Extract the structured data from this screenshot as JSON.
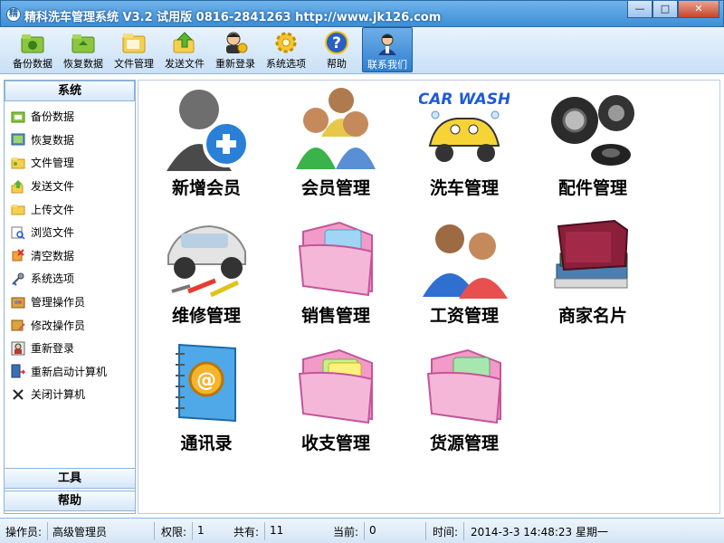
{
  "window": {
    "title": "精科洗车管理系统 V3.2 试用版 0816-2841263 http://www.jk126.com",
    "minimize": "—",
    "maximize": "□",
    "close": "✕"
  },
  "toolbar": {
    "items": [
      {
        "label": "备份数据",
        "icon": "backup-icon",
        "color": "#4caf50"
      },
      {
        "label": "恢复数据",
        "icon": "restore-icon",
        "color": "#4caf50"
      },
      {
        "label": "文件管理",
        "icon": "folder-icon",
        "color": "#f2c23b"
      },
      {
        "label": "发送文件",
        "icon": "send-icon",
        "color": "#e88d24"
      },
      {
        "label": "重新登录",
        "icon": "relogin-icon",
        "color": "#333333"
      },
      {
        "label": "系统选项",
        "icon": "gear-icon",
        "color": "#f1b91b"
      },
      {
        "label": "帮助",
        "icon": "help-icon",
        "color": "#2a5fc4"
      },
      {
        "label": "联系我们",
        "icon": "contact-icon",
        "color": "#ffffff"
      }
    ]
  },
  "sidebar": {
    "header": "系统",
    "items": [
      {
        "label": "备份数据",
        "icon": "backup-icon"
      },
      {
        "label": "恢复数据",
        "icon": "restore-icon"
      },
      {
        "label": "文件管理",
        "icon": "folder-icon"
      },
      {
        "label": "发送文件",
        "icon": "send-icon"
      },
      {
        "label": "上传文件",
        "icon": "upload-icon"
      },
      {
        "label": "浏览文件",
        "icon": "browse-icon"
      },
      {
        "label": "清空数据",
        "icon": "clear-icon"
      },
      {
        "label": "系统选项",
        "icon": "gear-icon"
      },
      {
        "label": "管理操作员",
        "icon": "admin-icon"
      },
      {
        "label": "修改操作员",
        "icon": "edit-user-icon"
      },
      {
        "label": "重新登录",
        "icon": "relogin-icon"
      },
      {
        "label": "重新启动计算机",
        "icon": "restart-icon"
      },
      {
        "label": "关闭计算机",
        "icon": "shutdown-icon"
      }
    ],
    "tools": "工具",
    "help": "帮助"
  },
  "main": {
    "tiles": [
      {
        "label": "新增会员",
        "icon": "add-member-icon"
      },
      {
        "label": "会员管理",
        "icon": "members-icon"
      },
      {
        "label": "洗车管理",
        "icon": "car-wash-icon"
      },
      {
        "label": "配件管理",
        "icon": "tires-icon"
      },
      {
        "label": "维修管理",
        "icon": "repair-icon"
      },
      {
        "label": "销售管理",
        "icon": "pink-folder-icon"
      },
      {
        "label": "工资管理",
        "icon": "people-icon"
      },
      {
        "label": "商家名片",
        "icon": "books-icon"
      },
      {
        "label": "通讯录",
        "icon": "address-book-icon"
      },
      {
        "label": "收支管理",
        "icon": "pink-folder-icon"
      },
      {
        "label": "货源管理",
        "icon": "pink-folder-icon"
      }
    ]
  },
  "status": {
    "operator_label": "操作员:",
    "operator_value": "高级管理员",
    "perm_label": "权限:",
    "perm_value": "1",
    "total_label": "共有:",
    "total_value": "11",
    "current_label": "当前:",
    "current_value": "0",
    "time_label": "时间:",
    "time_value": "2014-3-3 14:48:23 星期一"
  }
}
